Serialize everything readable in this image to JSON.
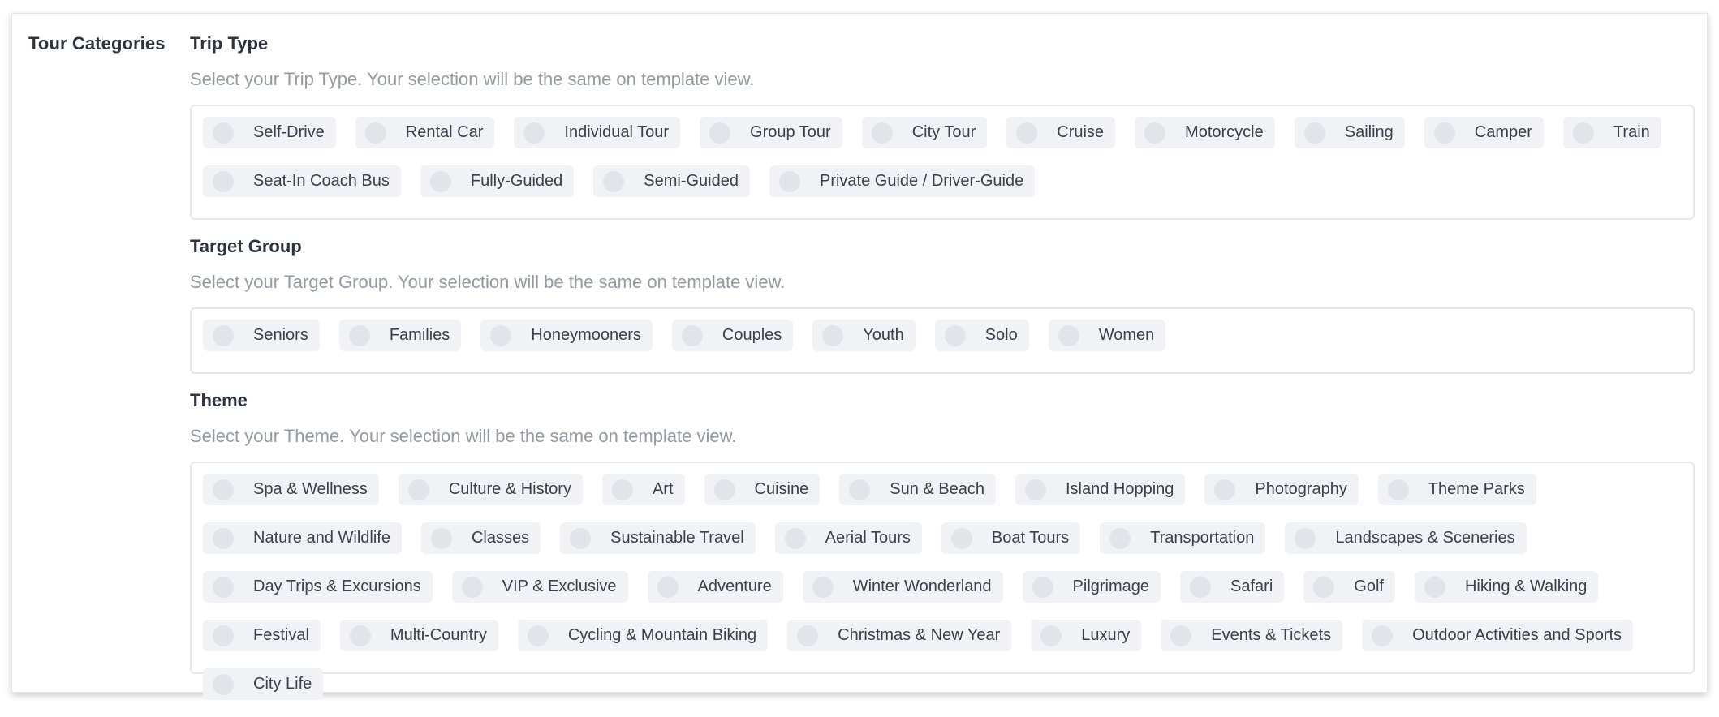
{
  "section_label": "Tour Categories",
  "groups": [
    {
      "title": "Trip Type",
      "description": "Select your Trip Type. Your selection will be the same on template view.",
      "options": [
        "Self-Drive",
        "Rental Car",
        "Individual Tour",
        "Group Tour",
        "City Tour",
        "Cruise",
        "Motorcycle",
        "Sailing",
        "Camper",
        "Train",
        "Seat-In Coach Bus",
        "Fully-Guided",
        "Semi-Guided",
        "Private Guide / Driver-Guide"
      ]
    },
    {
      "title": "Target Group",
      "description": "Select your Target Group. Your selection will be the same on template view.",
      "options": [
        "Seniors",
        "Families",
        "Honeymooners",
        "Couples",
        "Youth",
        "Solo",
        "Women"
      ]
    },
    {
      "title": "Theme",
      "description": "Select your Theme. Your selection will be the same on template view.",
      "options": [
        "Spa & Wellness",
        "Culture & History",
        "Art",
        "Cuisine",
        "Sun & Beach",
        "Island Hopping",
        "Photography",
        "Theme Parks",
        "Nature and Wildlife",
        "Classes",
        "Sustainable Travel",
        "Aerial Tours",
        "Boat Tours",
        "Transportation",
        "Landscapes & Sceneries",
        "Day Trips & Excursions",
        "VIP & Exclusive",
        "Adventure",
        "Winter Wonderland",
        "Pilgrimage",
        "Safari",
        "Golf",
        "Hiking & Walking",
        "Festival",
        "Multi-Country",
        "Cycling & Mountain Biking",
        "Christmas & New Year",
        "Luxury",
        "Events & Tickets",
        "Outdoor Activities and Sports",
        "City Life"
      ]
    }
  ],
  "colors": {
    "chip_bg": "#f1f2f5",
    "radio_unselected": "#e1e4e9",
    "description_text": "#9499a3",
    "border": "#e3e6ea"
  }
}
